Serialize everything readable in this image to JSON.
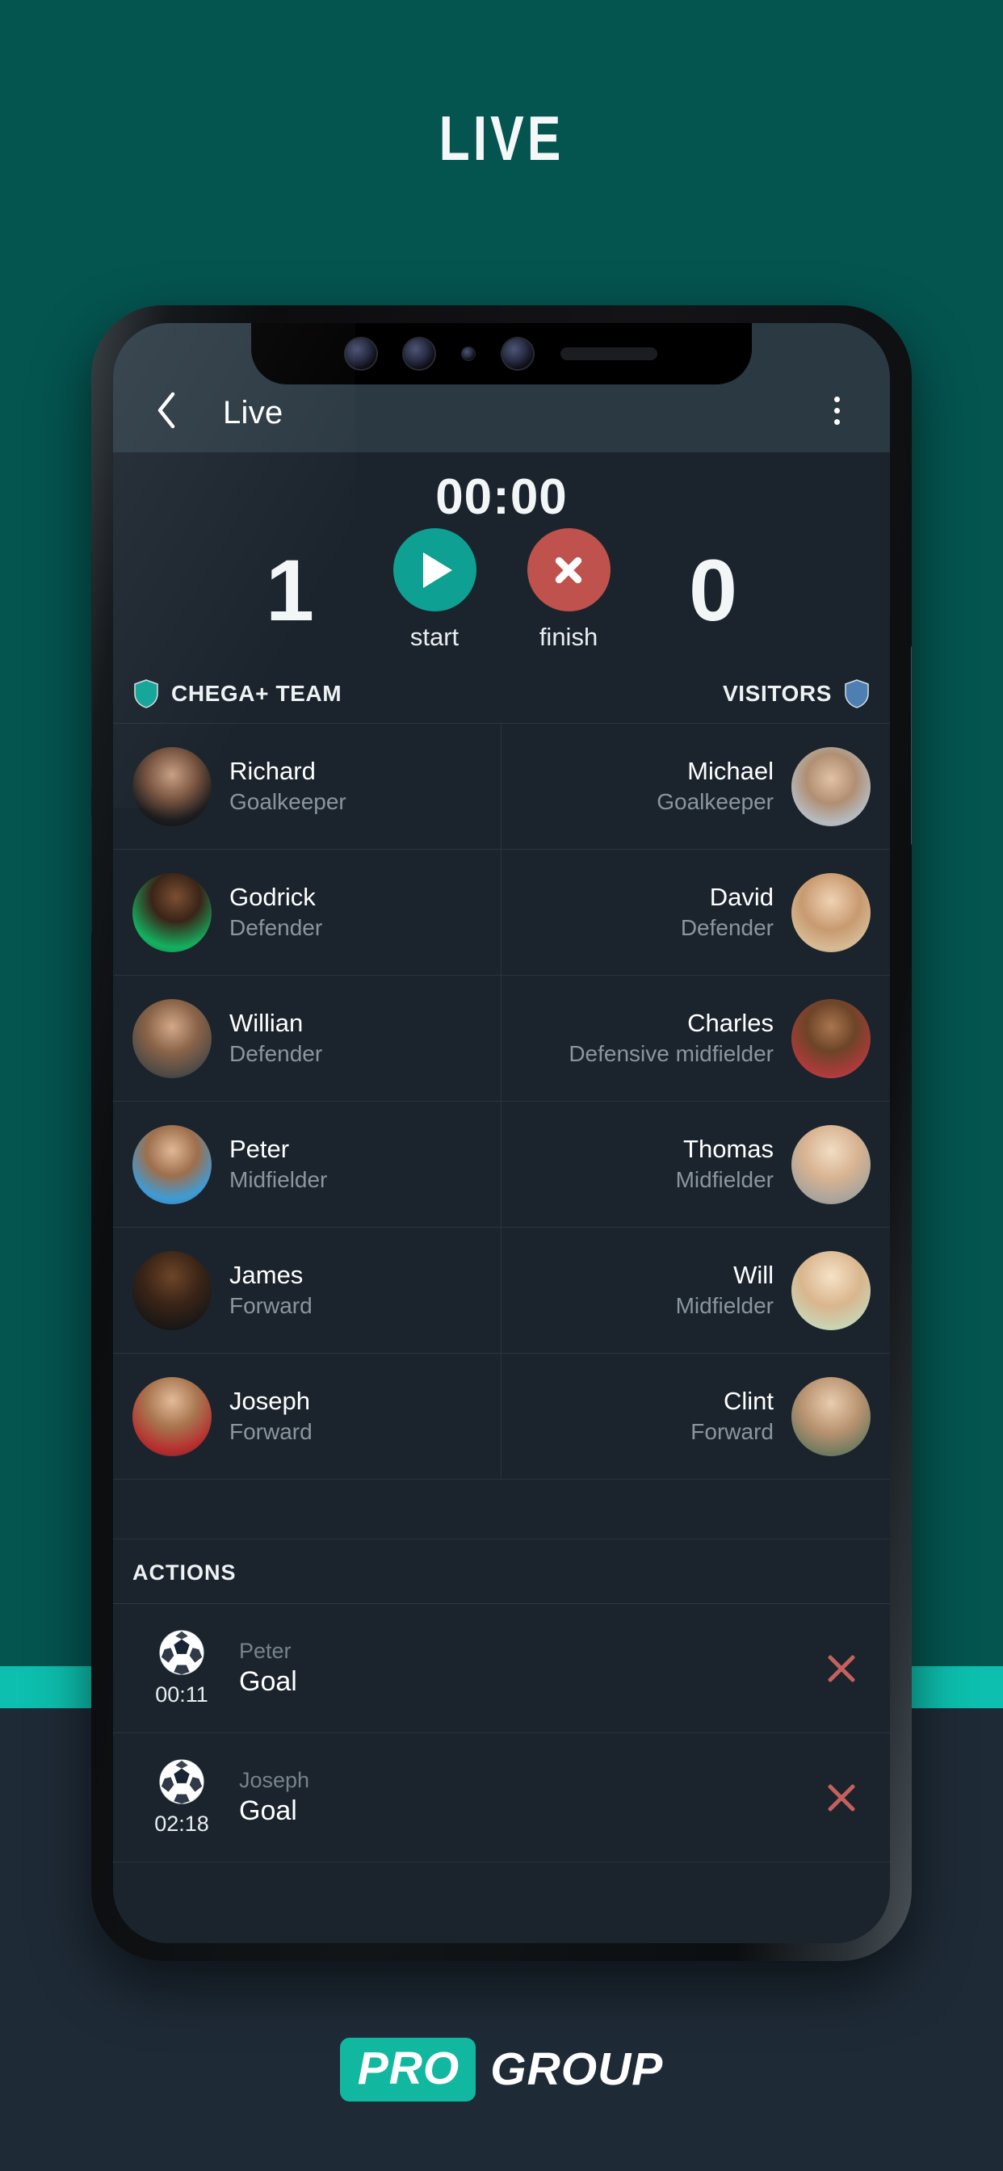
{
  "hero": {
    "title": "LIVE"
  },
  "app": {
    "header": {
      "back_icon": "chevron-left-icon",
      "title": "Live",
      "menu_icon": "kebab-menu-icon"
    },
    "scoreboard": {
      "timer": "00:00",
      "home_score": "1",
      "away_score": "0",
      "start_label": "start",
      "finish_label": "finish",
      "start_icon": "play-icon",
      "finish_icon": "close-circle-icon",
      "start_color": "#0fa094",
      "finish_color": "#bf524c"
    },
    "teams": {
      "home": {
        "name": "CHEGA+ TEAM",
        "shield_color": "#11a598",
        "shield_icon": "shield-icon"
      },
      "away": {
        "name": "VISITORS",
        "shield_color": "#4d7fb3",
        "shield_icon": "shield-icon"
      }
    },
    "players": [
      {
        "home": {
          "name": "Richard",
          "position": "Goalkeeper"
        },
        "away": {
          "name": "Michael",
          "position": "Goalkeeper"
        }
      },
      {
        "home": {
          "name": "Godrick",
          "position": "Defender"
        },
        "away": {
          "name": "David",
          "position": "Defender"
        }
      },
      {
        "home": {
          "name": "Willian",
          "position": "Defender"
        },
        "away": {
          "name": "Charles",
          "position": "Defensive midfielder"
        }
      },
      {
        "home": {
          "name": "Peter",
          "position": "Midfielder"
        },
        "away": {
          "name": "Thomas",
          "position": "Midfielder"
        }
      },
      {
        "home": {
          "name": "James",
          "position": "Forward"
        },
        "away": {
          "name": "Will",
          "position": "Midfielder"
        }
      },
      {
        "home": {
          "name": "Joseph",
          "position": "Forward"
        },
        "away": {
          "name": "Clint",
          "position": "Forward"
        }
      }
    ],
    "actions": {
      "section_label": "ACTIONS",
      "items": [
        {
          "icon": "soccer-ball-icon",
          "time": "00:11",
          "player": "Peter",
          "label": "Goal",
          "delete_icon": "close-icon"
        },
        {
          "icon": "soccer-ball-icon",
          "time": "02:18",
          "player": "Joseph",
          "label": "Goal",
          "delete_icon": "close-icon"
        }
      ]
    }
  },
  "footer": {
    "logo_primary": "PRO",
    "logo_secondary": "GROUP",
    "accent_color": "#12b79f"
  }
}
